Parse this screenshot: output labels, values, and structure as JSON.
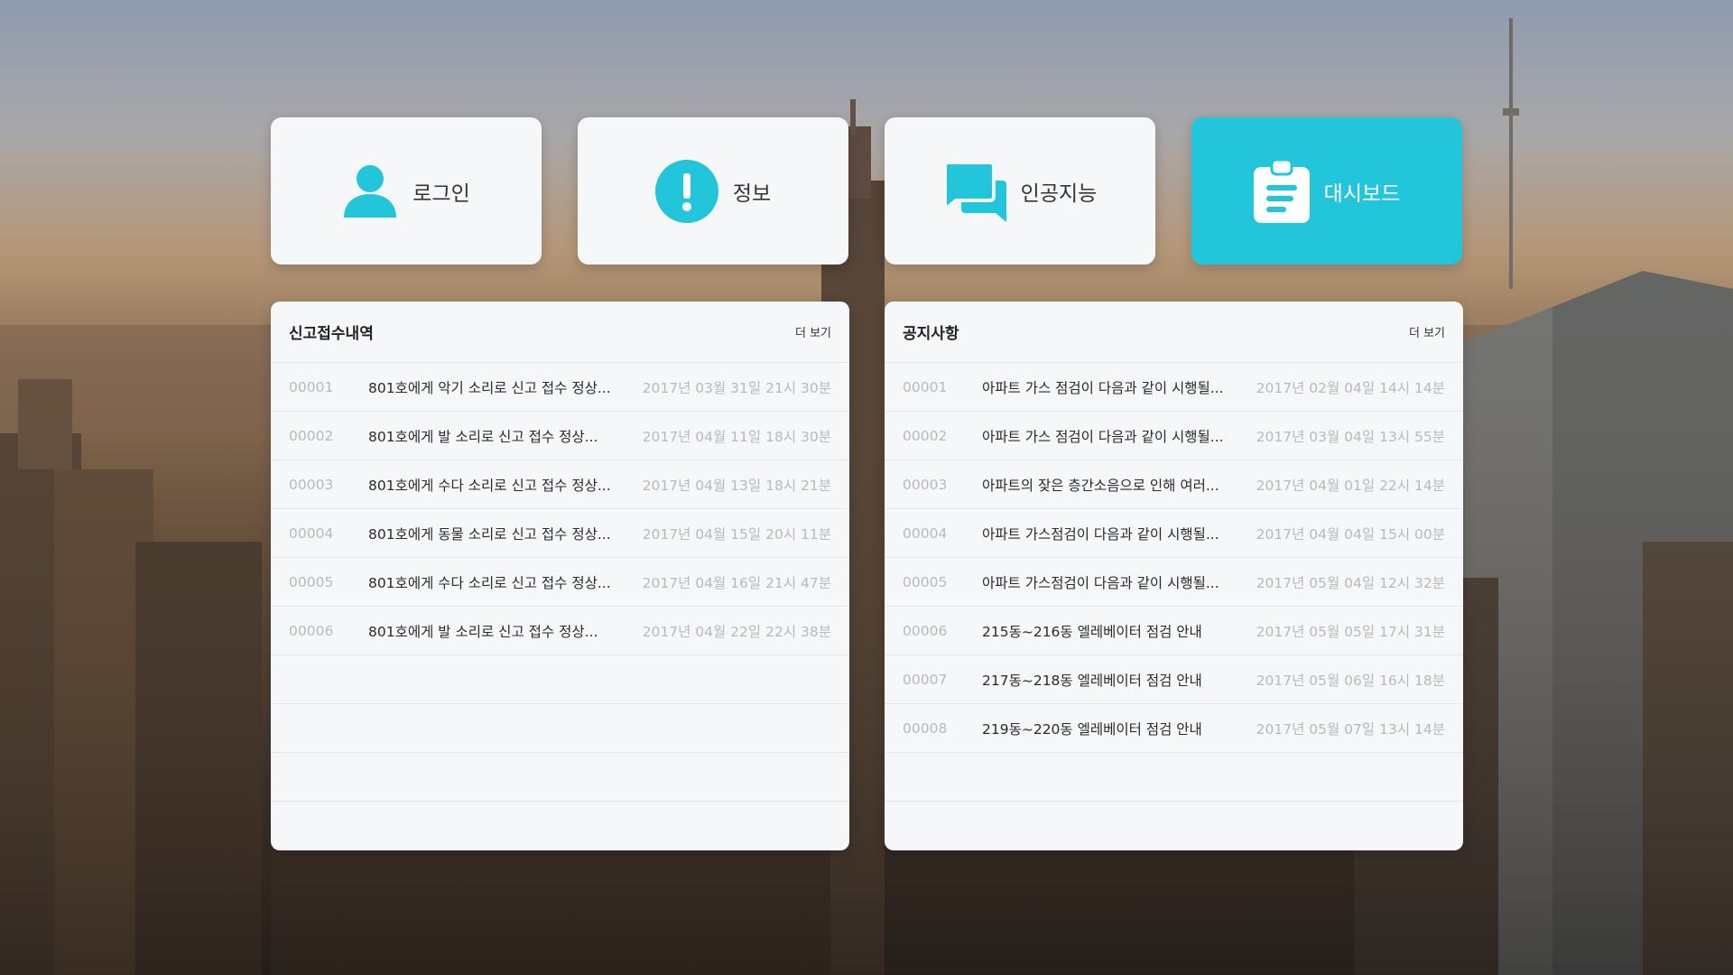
{
  "nav": {
    "items": [
      {
        "label": "로그인",
        "icon": "user-icon"
      },
      {
        "label": "정보",
        "icon": "info-exclamation-icon"
      },
      {
        "label": "인공지능",
        "icon": "chat-bubbles-icon"
      },
      {
        "label": "대시보드",
        "icon": "clipboard-icon",
        "active": true
      }
    ],
    "accent_color": "#22c5da"
  },
  "reports": {
    "title": "신고접수내역",
    "more_label": "더 보기",
    "rows": [
      {
        "num": "00001",
        "title": "801호에게 악기 소리로 신고 접수 정상...",
        "date": "2017년 03월 31일 21시 30분"
      },
      {
        "num": "00002",
        "title": "801호에게 발 소리로 신고 접수 정상...",
        "date": "2017년 04월 11일 18시 30분"
      },
      {
        "num": "00003",
        "title": "801호에게 수다 소리로 신고 접수 정상...",
        "date": "2017년 04월 13일 18시 21분"
      },
      {
        "num": "00004",
        "title": "801호에게 동물 소리로 신고 접수 정상...",
        "date": "2017년 04월 15일 20시 11분"
      },
      {
        "num": "00005",
        "title": "801호에게 수다 소리로 신고 접수 정상...",
        "date": "2017년 04월 16일 21시 47분"
      },
      {
        "num": "00006",
        "title": "801호에게 발 소리로 신고 접수 정상...",
        "date": "2017년 04월 22일 22시 38분"
      }
    ]
  },
  "notices": {
    "title": "공지사항",
    "more_label": "더 보기",
    "rows": [
      {
        "num": "00001",
        "title": "아파트 가스 점검이 다음과 같이 시행될...",
        "date": "2017년 02월 04일 14시 14분"
      },
      {
        "num": "00002",
        "title": "아파트 가스 점검이 다음과 같이 시행될...",
        "date": "2017년 03월 04일 13시 55분"
      },
      {
        "num": "00003",
        "title": "아파트의 잦은 층간소음으로 인해 여러...",
        "date": "2017년 04월 01일 22시 14분"
      },
      {
        "num": "00004",
        "title": "아파트 가스점검이 다음과 같이 시행될...",
        "date": "2017년 04월 04일 15시 00분"
      },
      {
        "num": "00005",
        "title": "아파트 가스점검이 다음과 같이 시행될...",
        "date": "2017년 05월 04일 12시 32분"
      },
      {
        "num": "00006",
        "title": "215동~216동 엘레베이터 점검 안내",
        "date": "2017년 05월 05일 17시 31분"
      },
      {
        "num": "00007",
        "title": "217동~218동 엘레베이터 점검 안내",
        "date": "2017년 05월 06일 16시 18분"
      },
      {
        "num": "00008",
        "title": "219동~220동 엘레베이터 점검 안내",
        "date": "2017년 05월 07일 13시 14분"
      }
    ]
  }
}
